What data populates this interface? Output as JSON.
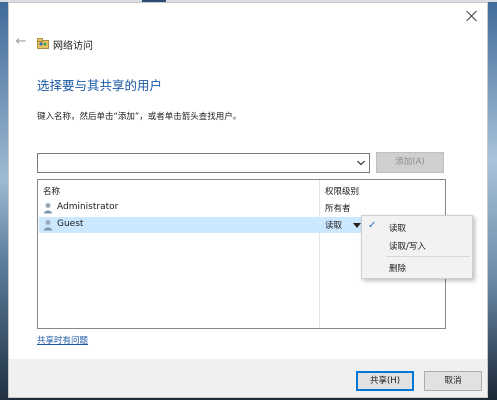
{
  "window": {
    "title": "网络访问",
    "close_icon": "close-icon",
    "back_icon": "back-arrow-icon"
  },
  "main": {
    "heading": "选择要与其共享的用户",
    "instruction": "键入名称，然后单击“添加”，或者单击箭头查找用户。",
    "combo_value": "",
    "add_button": "添加(A)"
  },
  "list": {
    "headers": {
      "name": "名称",
      "permission": "权限级别"
    },
    "rows": [
      {
        "name": "Administrator",
        "permission": "所有者",
        "selected": false
      },
      {
        "name": "Guest",
        "permission": "读取",
        "selected": true
      }
    ]
  },
  "context_menu": {
    "items": [
      {
        "label": "读取",
        "checked": true
      },
      {
        "label": "读取/写入",
        "checked": false
      },
      {
        "label": "删除",
        "checked": false
      }
    ]
  },
  "help_link": "共享时有问题",
  "footer": {
    "share_button": "共享(H)",
    "cancel_button": "取消"
  },
  "colors": {
    "accent": "#1c5aa6",
    "selection": "#cce8ff",
    "focus_border": "#0078d7"
  }
}
